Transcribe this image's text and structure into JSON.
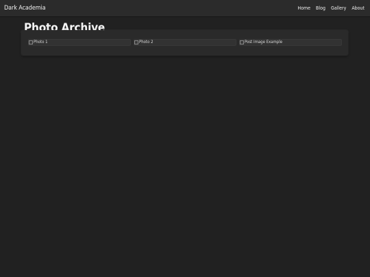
{
  "header": {
    "brand": "Dark Academia",
    "nav": [
      "Home",
      "Blog",
      "Gallery",
      "About"
    ]
  },
  "main": {
    "title": "Photo Archive",
    "photos": [
      {
        "alt": "Photo 1"
      },
      {
        "alt": "Photo 2"
      },
      {
        "alt": "Post Image Example"
      }
    ]
  },
  "colors": {
    "background": "#212121",
    "topbar": "#2b2b2b",
    "panel": "#2a2a2a",
    "text": "#f2f2f2"
  }
}
